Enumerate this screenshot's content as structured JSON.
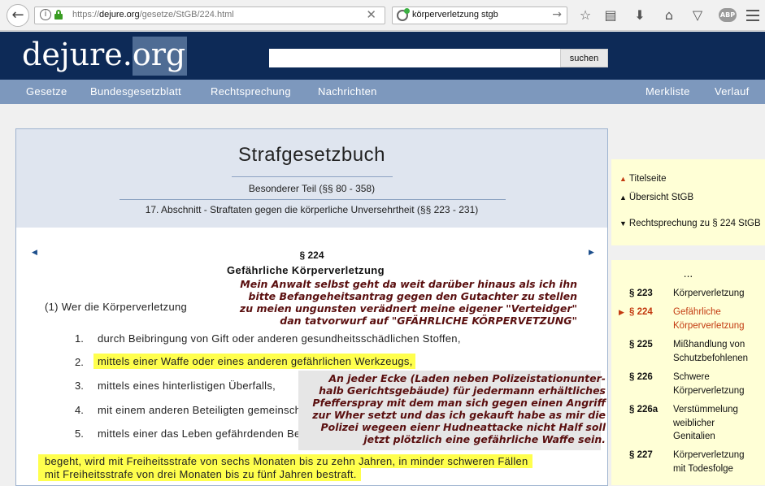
{
  "browser": {
    "url_prefix": "https://",
    "url_domain": "dejure.org",
    "url_path": "/gesetze/StGB/224.html",
    "search_query": "körperverletzung stgb"
  },
  "site": {
    "logo_main": "dejure.",
    "logo_org": "org",
    "search_button": "suchen",
    "nav_left": [
      "Gesetze",
      "Bundesgesetzblatt",
      "Rechtsprechung",
      "Nachrichten"
    ],
    "nav_right": [
      "Merkliste",
      "Verlauf"
    ]
  },
  "header": {
    "title": "Strafgesetzbuch",
    "part": "Besonderer Teil (§§ 80 - 358)",
    "section": "17. Abschnitt - Straftaten gegen die körperliche Unversehrtheit (§§ 223 - 231)"
  },
  "law": {
    "number": "§ 224",
    "title": "Gefährliche Körperverletzung",
    "intro": "(1) Wer die Körperverletzung",
    "items": [
      {
        "num": "1.",
        "text": "durch Beibringung von Gift oder anderen gesundheitsschädlichen Stoffen,"
      },
      {
        "num": "2.",
        "text": "mittels einer Waffe oder eines anderen gefährlichen Werkzeugs,"
      },
      {
        "num": "3.",
        "text": "mittels eines hinterlistigen Überfalls,"
      },
      {
        "num": "4.",
        "text": "mit einem anderen Beteiligten gemeinschaftlich oder"
      },
      {
        "num": "5.",
        "text": "mittels einer das Leben gefährdenden Behandlung"
      }
    ],
    "penalty_line1": "begeht, wird mit Freiheitsstrafe von sechs Monaten bis zu zehn Jahren, in minder schweren Fällen",
    "penalty_line2": "mit Freiheitsstrafe von drei Monaten bis zu fünf Jahren bestraft."
  },
  "annotations": {
    "note1": [
      "Mein Anwalt selbst geht da weit darüber hinaus als ich ihn",
      "bitte Befangeheitsantrag gegen den Gutachter zu stellen",
      "zu meien ungunsten verädnert meine eigener \"Verteidger\"",
      "dan tatvorwurf auf \"GFÄHRLICHE KÖRPERVETZUNG\""
    ],
    "note2": [
      "An jeder Ecke (Laden neben Polizeistationunter-",
      "halb Gerichtsgebäude) für jedermann erhältliches",
      "Pfefferspray mit dem man sich gegen einen Angriff",
      "zur Wher setzt und das ich gekauft habe as mir die",
      "Polizei wegeen eienr Hudneattacke nicht Half soll",
      "jetzt plötzlich eine gefährliche Waffe sein."
    ]
  },
  "sidebar_links": [
    {
      "label": "Titelseite",
      "marker": "▲",
      "color": "#c33a10"
    },
    {
      "label": "Übersicht StGB",
      "marker": "▲",
      "color": "#111111"
    },
    {
      "label": "Rechtsprechung zu § 224 StGB",
      "marker": "▼",
      "color": "#111111"
    }
  ],
  "sidebar_paragraphs": {
    "ellipsis": "...",
    "items": [
      {
        "num": "§ 223",
        "lines": [
          "Körperverletzung"
        ],
        "active": false
      },
      {
        "num": "§ 224",
        "lines": [
          "Gefährliche",
          "Körperverletzung"
        ],
        "active": true
      },
      {
        "num": "§ 225",
        "lines": [
          "Mißhandlung von",
          "Schutzbefohlenen"
        ],
        "active": false
      },
      {
        "num": "§ 226",
        "lines": [
          "Schwere",
          "Körperverletzung"
        ],
        "active": false
      },
      {
        "num": "§ 226a",
        "lines": [
          "Verstümmelung",
          "weiblicher",
          "Genitalien"
        ],
        "active": false
      },
      {
        "num": "§ 227",
        "lines": [
          "Körperverletzung",
          "mit Todesfolge"
        ],
        "active": false
      }
    ]
  },
  "colors": {
    "header_bg": "#0d2a57",
    "nav_bg": "#7d98bd",
    "highlight": "#ffff4d",
    "annotation_text": "#5a0f0f",
    "sidebar_bg": "#ffffd6",
    "active_link": "#c33a10"
  }
}
